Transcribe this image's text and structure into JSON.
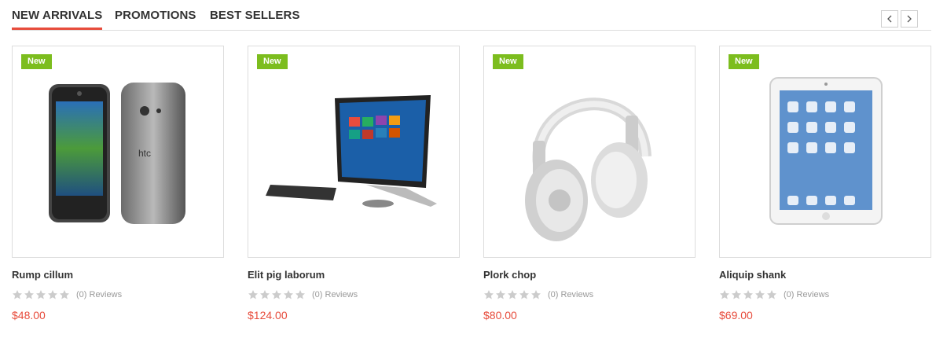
{
  "tabs": [
    {
      "label": "NEW ARRIVALS",
      "active": true
    },
    {
      "label": "PROMOTIONS",
      "active": false
    },
    {
      "label": "BEST SELLERS",
      "active": false
    }
  ],
  "nav": {
    "prev_icon": "chevron-left-icon",
    "next_icon": "chevron-right-icon"
  },
  "colors": {
    "accent": "#e74c3c",
    "badge": "#7cbd1e",
    "price": "#e74c3c",
    "star": "#cccccc"
  },
  "products": [
    {
      "badge": "New",
      "title": "Rump cillum",
      "reviews": "(0) Reviews",
      "price": "$48.00",
      "rating": 0,
      "image": "phone-image"
    },
    {
      "badge": "New",
      "title": "Elit pig laborum",
      "reviews": "(0) Reviews",
      "price": "$124.00",
      "rating": 0,
      "image": "all-in-one-pc-image"
    },
    {
      "badge": "New",
      "title": "Plork chop",
      "reviews": "(0) Reviews",
      "price": "$80.00",
      "rating": 0,
      "image": "headphones-image"
    },
    {
      "badge": "New",
      "title": "Aliquip shank",
      "reviews": "(0) Reviews",
      "price": "$69.00",
      "rating": 0,
      "image": "tablet-image"
    }
  ]
}
